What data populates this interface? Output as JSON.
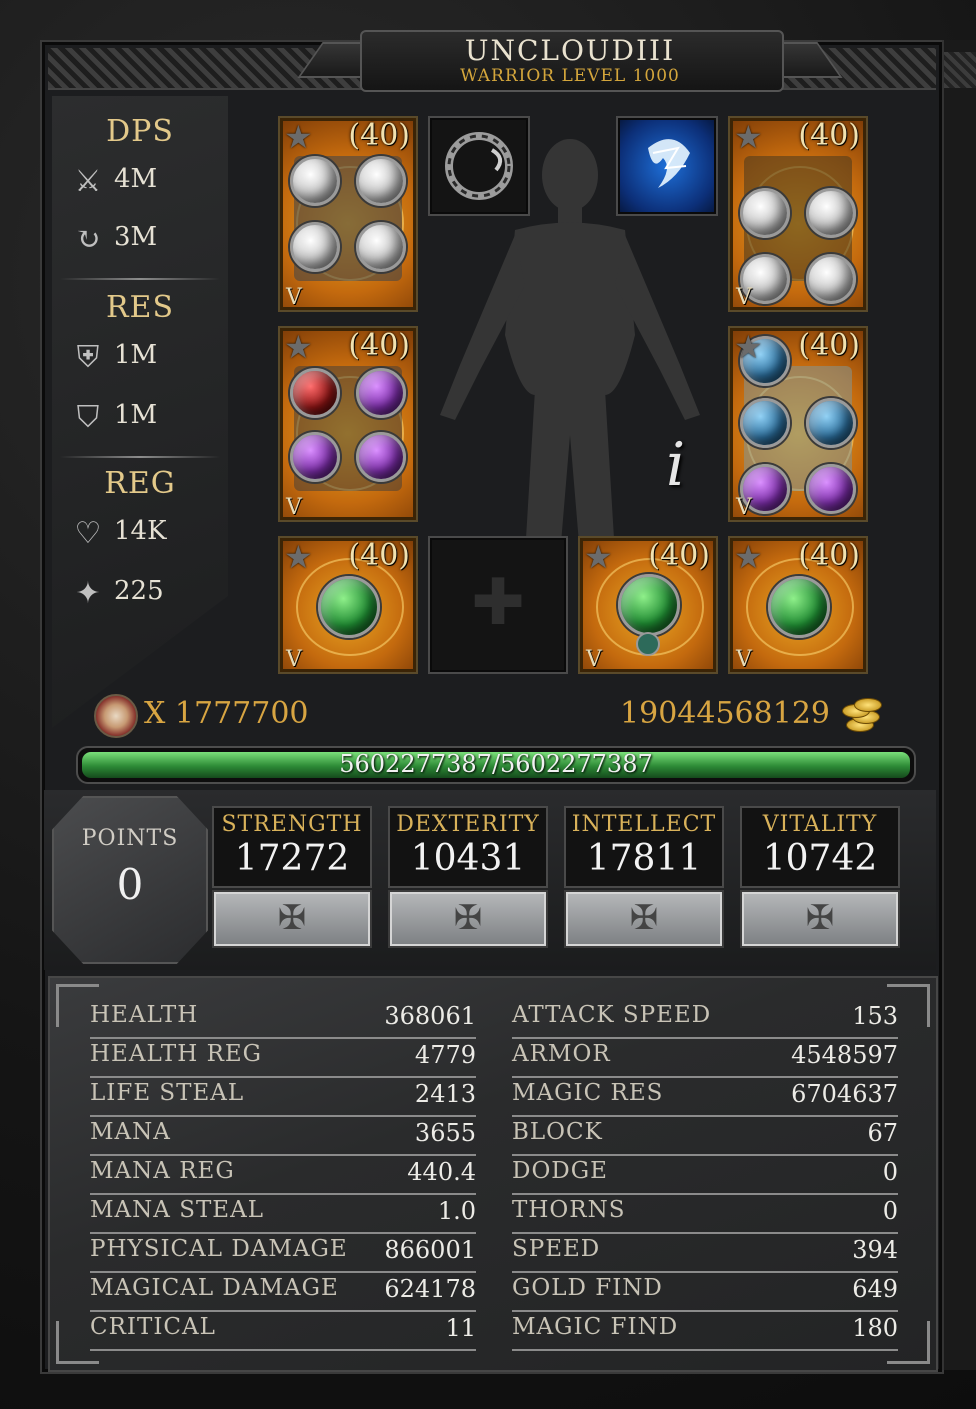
{
  "header": {
    "name": "UNCLOUDIII",
    "subtitle": "WARRIOR LEVEL 1000"
  },
  "side_panel": {
    "dps_label": "DPS",
    "dps": [
      {
        "icon": "crossed-swords-icon",
        "value": "4M"
      },
      {
        "icon": "swirl-magic-icon",
        "value": "3M"
      }
    ],
    "res_label": "RES",
    "res": [
      {
        "icon": "shield-swords-icon",
        "value": "1M"
      },
      {
        "icon": "shield-swirl-icon",
        "value": "1M"
      }
    ],
    "reg_label": "REG",
    "reg": [
      {
        "icon": "heart-plus-icon",
        "value": "14K"
      },
      {
        "icon": "mana-plus-icon",
        "value": "225"
      }
    ]
  },
  "equipment": {
    "helm": {
      "level": "(40)",
      "tier": "V"
    },
    "amulet_slot": {
      "icon": "serpent-ring-icon"
    },
    "skill_slot": {
      "icon": "lightning-spirit-icon"
    },
    "chest": {
      "level": "(40)",
      "tier": "V"
    },
    "weapon": {
      "level": "(40)",
      "tier": "V"
    },
    "shield": {
      "level": "(40)",
      "tier": "V"
    },
    "ring_left": {
      "level": "(40)",
      "tier": "V"
    },
    "empty_slot": {
      "icon": "cross-placeholder-icon"
    },
    "necklace": {
      "level": "(40)",
      "tier": "V"
    },
    "ring_right": {
      "level": "(40)",
      "tier": "V"
    },
    "info_glyph": "i"
  },
  "currency": {
    "kills": "X 1777700",
    "gold": "19044568129"
  },
  "experience": {
    "text": "5602277387/5602277387",
    "fill_fraction": 1.0,
    "color": "#2d8a36"
  },
  "attributes": {
    "points_label": "POINTS",
    "points_value": "0",
    "items": [
      {
        "name": "STRENGTH",
        "value": "17272"
      },
      {
        "name": "DEXTERITY",
        "value": "10431"
      },
      {
        "name": "INTELLECT",
        "value": "17811"
      },
      {
        "name": "VITALITY",
        "value": "10742"
      }
    ]
  },
  "stats": {
    "left": [
      {
        "label": "HEALTH",
        "value": "368061"
      },
      {
        "label": "HEALTH REG",
        "value": "4779"
      },
      {
        "label": "LIFE STEAL",
        "value": "2413"
      },
      {
        "label": "MANA",
        "value": "3655"
      },
      {
        "label": "MANA REG",
        "value": "440.4"
      },
      {
        "label": "MANA STEAL",
        "value": "1.0"
      },
      {
        "label": "PHYSICAL DAMAGE",
        "value": "866001"
      },
      {
        "label": "MAGICAL DAMAGE",
        "value": "624178"
      },
      {
        "label": "CRITICAL",
        "value": "11"
      }
    ],
    "right": [
      {
        "label": "ATTACK SPEED",
        "value": "153"
      },
      {
        "label": "ARMOR",
        "value": "4548597"
      },
      {
        "label": "MAGIC RES",
        "value": "6704637"
      },
      {
        "label": "BLOCK",
        "value": "67"
      },
      {
        "label": "DODGE",
        "value": "0"
      },
      {
        "label": "THORNS",
        "value": "0"
      },
      {
        "label": "SPEED",
        "value": "394"
      },
      {
        "label": "GOLD FIND",
        "value": "649"
      },
      {
        "label": "MAGIC FIND",
        "value": "180"
      }
    ]
  }
}
